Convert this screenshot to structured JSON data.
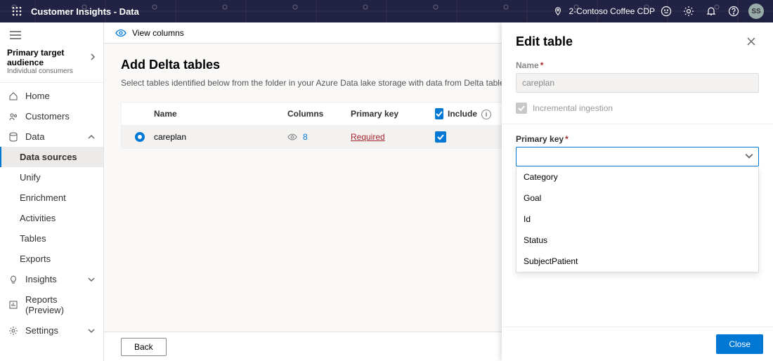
{
  "topbar": {
    "title": "Customer Insights - Data",
    "context": "2-Contoso Coffee CDP",
    "avatar_initials": "SS"
  },
  "sidebar": {
    "audience_title": "Primary target audience",
    "audience_subtitle": "Individual consumers",
    "items": {
      "home": "Home",
      "customers": "Customers",
      "data": "Data",
      "data_sources": "Data sources",
      "unify": "Unify",
      "enrichment": "Enrichment",
      "activities": "Activities",
      "tables": "Tables",
      "exports": "Exports",
      "insights": "Insights",
      "reports": "Reports (Preview)",
      "settings": "Settings"
    }
  },
  "commandbar": {
    "view_columns": "View columns"
  },
  "main": {
    "heading": "Add Delta tables",
    "description": "Select tables identified below from the folder in your Azure Data lake storage with data from Delta tables.",
    "columns": {
      "name": "Name",
      "columns": "Columns",
      "primary_key": "Primary key",
      "include": "Include"
    },
    "rows": [
      {
        "name": "careplan",
        "columns": "8",
        "primary_key": "Required",
        "included": true,
        "selected": true
      }
    ],
    "back_label": "Back"
  },
  "panel": {
    "title": "Edit table",
    "name_label": "Name",
    "name_value": "careplan",
    "incremental_label": "Incremental ingestion",
    "primary_key_label": "Primary key",
    "primary_key_value": "",
    "options": [
      "Category",
      "Goal",
      "Id",
      "Status",
      "SubjectPatient"
    ],
    "close_label": "Close"
  }
}
